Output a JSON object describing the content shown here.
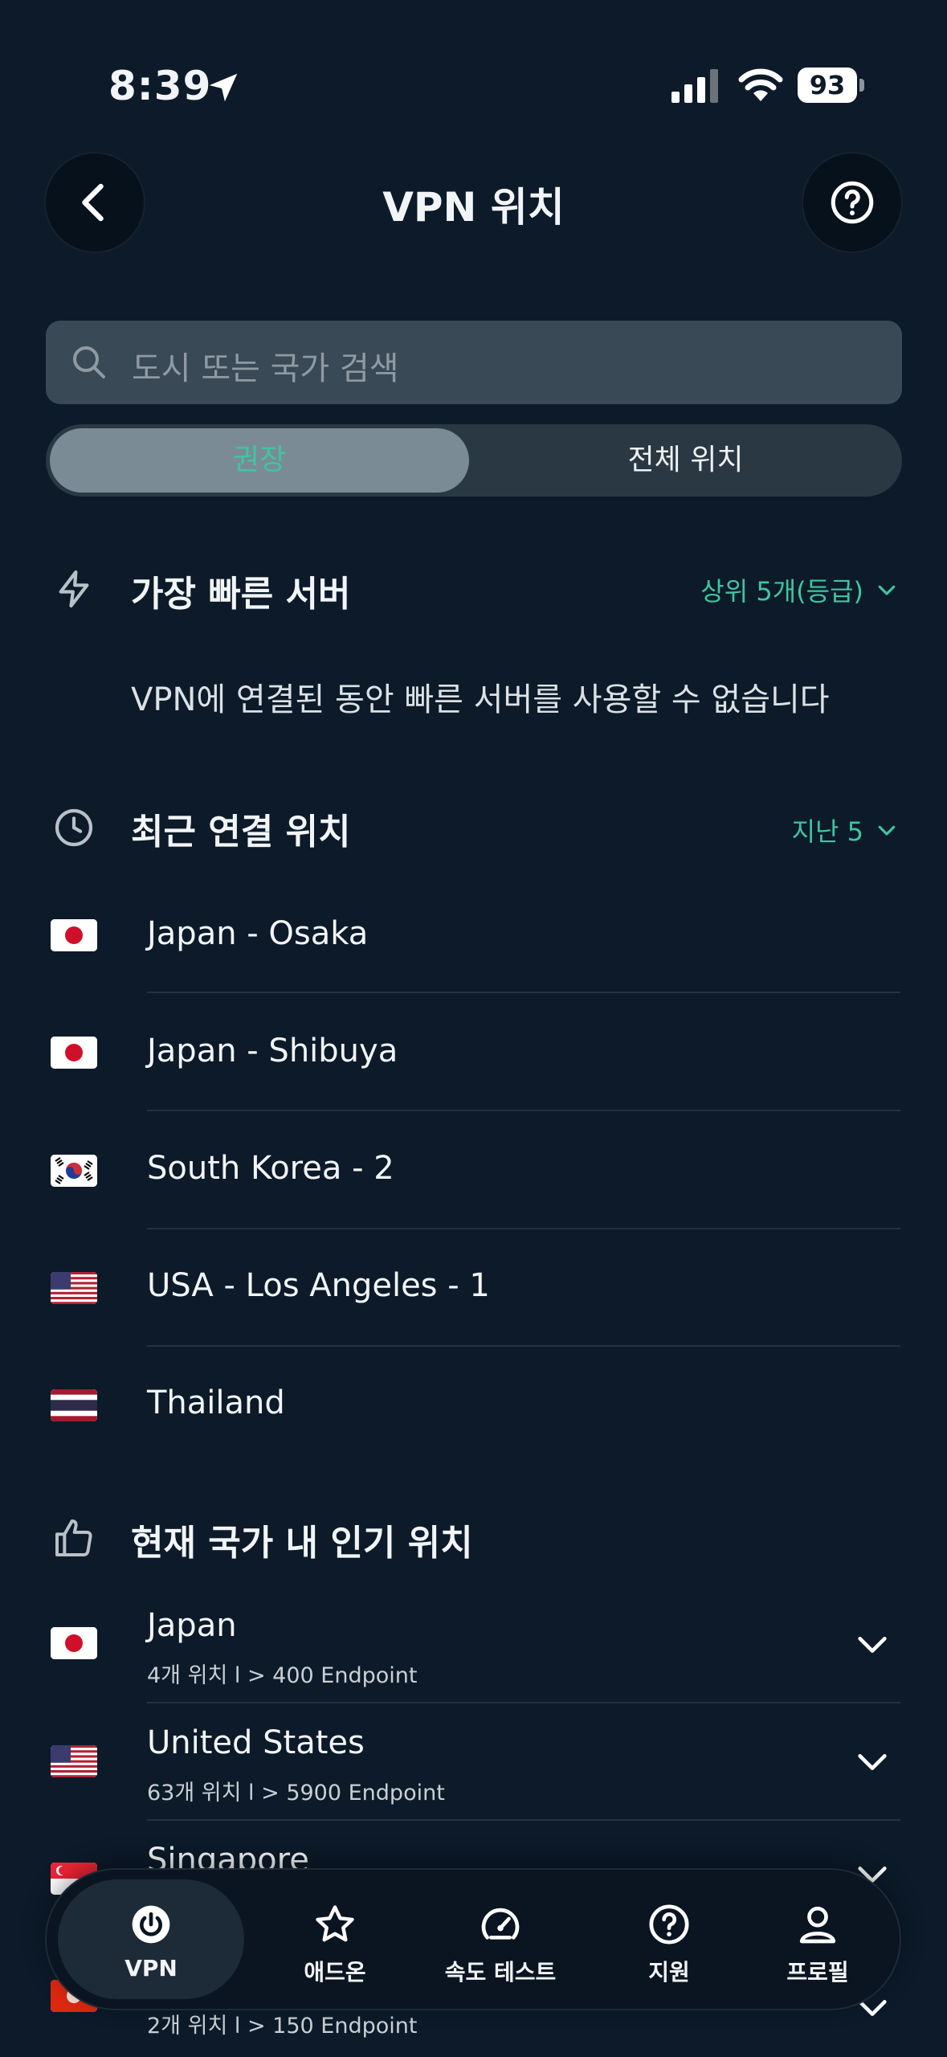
{
  "status_bar": {
    "time": "8:39",
    "battery": "93"
  },
  "header": {
    "title": "VPN 위치"
  },
  "search": {
    "placeholder": "도시 또는 국가 검색"
  },
  "tabs": {
    "recommended": "권장",
    "all": "전체 위치"
  },
  "fastest": {
    "title": "가장 빠른 서버",
    "filter": "상위 5개(등급)",
    "notice": "VPN에 연결된 동안 빠른 서버를 사용할 수 없습니다"
  },
  "recent": {
    "title": "최근 연결 위치",
    "filter": "지난 5",
    "items": [
      {
        "label": "Japan - Osaka",
        "flag": "japan"
      },
      {
        "label": "Japan - Shibuya",
        "flag": "japan"
      },
      {
        "label": "South Korea - 2",
        "flag": "south-korea"
      },
      {
        "label": "USA - Los Angeles - 1",
        "flag": "usa"
      },
      {
        "label": "Thailand",
        "flag": "thailand"
      }
    ]
  },
  "popular": {
    "title": "현재 국가 내 인기 위치",
    "items": [
      {
        "label": "Japan",
        "sub": "4개 위치    l >   400 Endpoint",
        "flag": "japan"
      },
      {
        "label": "United States",
        "sub": "63개 위치    l >   5900 Endpoint",
        "flag": "usa"
      },
      {
        "label": "Singapore",
        "sub": "",
        "flag": "singapore"
      },
      {
        "label": "",
        "sub": "2개 위치    l >   150 Endpoint",
        "flag": "hong-kong"
      }
    ]
  },
  "bottom_nav": [
    {
      "label": "VPN",
      "icon": "power-icon",
      "active": true
    },
    {
      "label": "애드온",
      "icon": "star-icon",
      "active": false
    },
    {
      "label": "속도 테스트",
      "icon": "speedometer-icon",
      "active": false
    },
    {
      "label": "지원",
      "icon": "help-circle-icon",
      "active": false
    },
    {
      "label": "프로필",
      "icon": "person-icon",
      "active": false
    }
  ],
  "colors": {
    "background": "#0c1a29",
    "accent": "#3ec6a0",
    "search_bg": "#394955"
  }
}
